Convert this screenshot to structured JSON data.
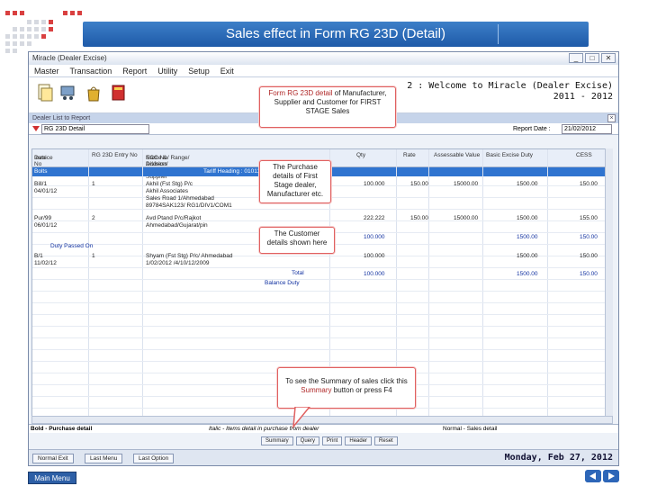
{
  "slide": {
    "title": "Sales effect in Form RG 23D (Detail)",
    "main_menu_label": "Main Menu",
    "prev_icon": "left-arrow-icon",
    "next_icon": "right-arrow-icon"
  },
  "window": {
    "title": "Miracle (Dealer Excise)",
    "menu": [
      "Master",
      "Transaction",
      "Report",
      "Utility",
      "Setup",
      "Exit"
    ],
    "welcome_line1": "2 : Welcome to Miracle (Dealer Excise)",
    "welcome_line2": "2011 - 2012",
    "toolbar_icons": [
      "document-icon",
      "cart-icon",
      "bag-icon",
      "book-icon"
    ]
  },
  "report": {
    "subwindow_title": "Dealer List to Report",
    "filter_value": "RG 23D Detail",
    "report_date_label": "Report Date :",
    "report_date_value": "21/02/2012",
    "columns": [
      "Invoice No",
      "RG 23D Entry No",
      "Name & Address of Supplier",
      "Qty",
      "Rate",
      "Assessable Value",
      "Basic Excise Duty",
      "CESS"
    ],
    "column_sub": [
      "Date",
      "",
      "ECC No/ Range/ Division/ Commissionerate",
      "",
      "",
      "",
      "",
      ""
    ],
    "highlight_row": {
      "c0": "Bolts",
      "c2": "Tariff Heading : 01011010"
    },
    "rows": [
      {
        "c0": "Bill/1",
        "c1": "1",
        "c2": "Akhil (Fst Stg) P/c",
        "c3": "100.000",
        "c4": "150.00",
        "c5": "15000.00",
        "c6": "1500.00",
        "c7": "150.00"
      },
      {
        "c0": "04/01/12",
        "c1": "",
        "c2": "Akhil Associates",
        "c3": "",
        "c4": "",
        "c5": "",
        "c6": "",
        "c7": ""
      },
      {
        "c0": "",
        "c1": "",
        "c2": "Sales Road 1/Ahmedabad",
        "c3": "",
        "c4": "",
        "c5": "",
        "c6": "",
        "c7": ""
      },
      {
        "c0": "",
        "c1": "",
        "c2": "89784SAK123/ RG1/DIV1/COM1",
        "c3": "",
        "c4": "",
        "c5": "",
        "c6": "",
        "c7": ""
      },
      {
        "c0": "Pur/99",
        "c1": "2",
        "c2": "Avd Ptand P/c/Rajkot",
        "c3": "222.222",
        "c4": "150.00",
        "c5": "15000.00",
        "c6": "1500.00",
        "c7": "155.00"
      },
      {
        "c0": "06/01/12",
        "c1": "",
        "c2": "Ahmedabad/Gujarat/pin",
        "c3": "",
        "c4": "",
        "c5": "",
        "c6": "",
        "c7": ""
      }
    ],
    "total_label": "Total",
    "total1": {
      "qty": "100.000",
      "bed": "1500.00",
      "cess": "150.00"
    },
    "duty_passed_label": "Duty Passed On",
    "rows2": [
      {
        "c0": "B/1",
        "c1": "1",
        "c2": "Shyam (Fst Stg) P/c/ Ahmedabad",
        "c3": "100.000",
        "c6": "1500.00",
        "c7": "150.00"
      },
      {
        "c0": "11/02/12",
        "c1": "",
        "c2": "1/02/2012 /4/10/12/2009",
        "c3": "",
        "c6": "",
        "c7": ""
      }
    ],
    "total2": {
      "qty": "100.000",
      "bed": "1500.00",
      "cess": "150.00"
    },
    "balance_duty_label": "Balance Duty",
    "status_left": "Bold - Purchase detail",
    "status_mid": "Italic - Items detail in purchase from dealer",
    "status_right": "Normal - Sales detail",
    "bottom_buttons": [
      "Summary",
      "Query",
      "Print",
      "Header",
      "Reset"
    ],
    "task_buttons": [
      "Normal Exit",
      "Last Menu",
      "Last Option"
    ],
    "date_text": "Monday, Feb 27, 2012"
  },
  "callouts": {
    "c1_part1": "Form RG 23D detail",
    "c1_part2": " of Manufacturer, Supplier and Customer for FIRST STAGE Sales",
    "c2": "The Purchase details of First Stage dealer, Manufacturer etc.",
    "c3": "The Customer details shown here",
    "c4_part1": "To see the Summary of sales click this ",
    "c4_em": "Summary",
    "c4_part2": " button or press F4"
  },
  "colors": {
    "title_bar": "#1e5aa8",
    "highlight_row": "#2f74d0",
    "callout_border": "#e06060"
  }
}
